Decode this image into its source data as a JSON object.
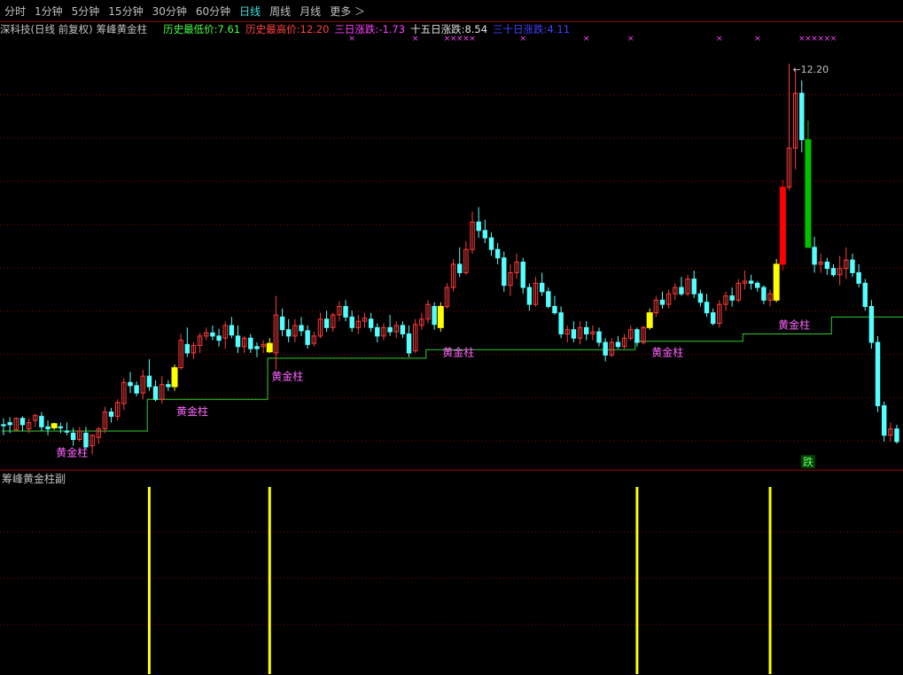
{
  "toolbar": {
    "tabs": [
      "分时",
      "1分钟",
      "5分钟",
      "15分钟",
      "30分钟",
      "60分钟",
      "日线",
      "周线",
      "月线",
      "更多 ＞"
    ],
    "active": "日线"
  },
  "info": {
    "stock": "深科技(日线 前复权)",
    "indicator": "筹峰黄金柱",
    "low_label": "历史最低价:",
    "low_value": "7.61",
    "high_label": "历史最高价:",
    "high_value": "12.20",
    "d3_label": "三日涨跌:",
    "d3_value": "-1.73",
    "d15_label": "十五日涨跌:",
    "d15_value": "8.54",
    "d30_label": "三十日涨跌:",
    "d30_value": "4.11"
  },
  "sub_title": "筹峰黄金柱副",
  "colors": {
    "up": "#ff3a3a",
    "down": "#54ffff",
    "gold": "#ffff00",
    "line": "#33cc33",
    "label": "#ff66ff",
    "grid": "#8b0000",
    "strong_up": "#ff0000",
    "strong_down": "#00c000"
  },
  "chart_data": {
    "type": "candlestick",
    "high_marker": "12.20",
    "gold_label": "黄金柱",
    "fall_label": "跌",
    "candles": [
      {
        "o": 8.78,
        "h": 8.84,
        "l": 8.68,
        "c": 8.77
      },
      {
        "o": 8.8,
        "h": 8.85,
        "l": 8.7,
        "c": 8.78
      },
      {
        "o": 8.73,
        "h": 8.85,
        "l": 8.73,
        "c": 8.84
      },
      {
        "o": 8.84,
        "h": 8.86,
        "l": 8.72,
        "c": 8.78
      },
      {
        "o": 8.74,
        "h": 8.84,
        "l": 8.7,
        "c": 8.8
      },
      {
        "o": 8.82,
        "h": 8.88,
        "l": 8.76,
        "c": 8.87
      },
      {
        "o": 8.86,
        "h": 8.9,
        "l": 8.72,
        "c": 8.76
      },
      {
        "o": 8.76,
        "h": 8.82,
        "l": 8.68,
        "c": 8.74
      },
      {
        "o": 8.75,
        "h": 8.8,
        "l": 8.73,
        "c": 8.79,
        "g": 1
      },
      {
        "o": 8.76,
        "h": 8.8,
        "l": 8.7,
        "c": 8.75
      },
      {
        "o": 8.72,
        "h": 8.8,
        "l": 8.68,
        "c": 8.71
      },
      {
        "o": 8.7,
        "h": 8.75,
        "l": 8.58,
        "c": 8.64
      },
      {
        "o": 8.64,
        "h": 8.76,
        "l": 8.62,
        "c": 8.72
      },
      {
        "o": 8.7,
        "h": 8.76,
        "l": 8.55,
        "c": 8.57
      },
      {
        "o": 8.58,
        "h": 8.69,
        "l": 8.5,
        "c": 8.68
      },
      {
        "o": 8.66,
        "h": 8.76,
        "l": 8.6,
        "c": 8.74
      },
      {
        "o": 8.74,
        "h": 8.95,
        "l": 8.7,
        "c": 8.9
      },
      {
        "o": 8.9,
        "h": 8.94,
        "l": 8.8,
        "c": 8.86
      },
      {
        "o": 8.86,
        "h": 9.02,
        "l": 8.82,
        "c": 8.99
      },
      {
        "o": 8.98,
        "h": 9.22,
        "l": 8.92,
        "c": 9.18
      },
      {
        "o": 9.18,
        "h": 9.28,
        "l": 9.08,
        "c": 9.15
      },
      {
        "o": 9.15,
        "h": 9.19,
        "l": 9.05,
        "c": 9.08
      },
      {
        "o": 9.08,
        "h": 9.3,
        "l": 9.02,
        "c": 9.24
      },
      {
        "o": 9.24,
        "h": 9.4,
        "l": 9.1,
        "c": 9.14
      },
      {
        "o": 9.14,
        "h": 9.2,
        "l": 9.0,
        "c": 9.02
      },
      {
        "o": 9.02,
        "h": 9.24,
        "l": 8.98,
        "c": 9.16
      },
      {
        "o": 9.16,
        "h": 9.2,
        "l": 9.1,
        "c": 9.14
      },
      {
        "o": 9.14,
        "h": 9.35,
        "l": 9.1,
        "c": 9.32,
        "g": 1
      },
      {
        "o": 9.32,
        "h": 9.64,
        "l": 9.3,
        "c": 9.58
      },
      {
        "o": 9.54,
        "h": 9.7,
        "l": 9.42,
        "c": 9.46
      },
      {
        "o": 9.46,
        "h": 9.56,
        "l": 9.4,
        "c": 9.53
      },
      {
        "o": 9.53,
        "h": 9.65,
        "l": 9.46,
        "c": 9.62
      },
      {
        "o": 9.62,
        "h": 9.7,
        "l": 9.58,
        "c": 9.65
      },
      {
        "o": 9.65,
        "h": 9.72,
        "l": 9.58,
        "c": 9.62
      },
      {
        "o": 9.62,
        "h": 9.69,
        "l": 9.52,
        "c": 9.58
      },
      {
        "o": 9.6,
        "h": 9.76,
        "l": 9.5,
        "c": 9.72
      },
      {
        "o": 9.72,
        "h": 9.8,
        "l": 9.6,
        "c": 9.63
      },
      {
        "o": 9.62,
        "h": 9.72,
        "l": 9.46,
        "c": 9.52
      },
      {
        "o": 9.52,
        "h": 9.62,
        "l": 9.46,
        "c": 9.6
      },
      {
        "o": 9.6,
        "h": 9.64,
        "l": 9.46,
        "c": 9.5
      },
      {
        "o": 9.52,
        "h": 9.56,
        "l": 9.42,
        "c": 9.5
      },
      {
        "o": 9.52,
        "h": 9.58,
        "l": 9.46,
        "c": 9.54
      },
      {
        "o": 9.55,
        "h": 9.6,
        "l": 9.46,
        "c": 9.47,
        "g": 1
      },
      {
        "o": 9.46,
        "h": 10.0,
        "l": 9.3,
        "c": 9.82
      },
      {
        "o": 9.8,
        "h": 9.88,
        "l": 9.62,
        "c": 9.68
      },
      {
        "o": 9.68,
        "h": 9.78,
        "l": 9.56,
        "c": 9.62
      },
      {
        "o": 9.62,
        "h": 9.78,
        "l": 9.56,
        "c": 9.72
      },
      {
        "o": 9.72,
        "h": 9.8,
        "l": 9.62,
        "c": 9.67
      },
      {
        "o": 9.67,
        "h": 9.72,
        "l": 9.5,
        "c": 9.54
      },
      {
        "o": 9.55,
        "h": 9.66,
        "l": 9.52,
        "c": 9.62
      },
      {
        "o": 9.62,
        "h": 9.84,
        "l": 9.6,
        "c": 9.78
      },
      {
        "o": 9.78,
        "h": 9.86,
        "l": 9.66,
        "c": 9.7
      },
      {
        "o": 9.7,
        "h": 9.84,
        "l": 9.66,
        "c": 9.82
      },
      {
        "o": 9.82,
        "h": 9.95,
        "l": 9.76,
        "c": 9.9
      },
      {
        "o": 9.9,
        "h": 9.96,
        "l": 9.76,
        "c": 9.8
      },
      {
        "o": 9.8,
        "h": 9.86,
        "l": 9.66,
        "c": 9.7
      },
      {
        "o": 9.7,
        "h": 9.82,
        "l": 9.64,
        "c": 9.76
      },
      {
        "o": 9.76,
        "h": 9.84,
        "l": 9.7,
        "c": 9.79
      },
      {
        "o": 9.78,
        "h": 9.84,
        "l": 9.66,
        "c": 9.7
      },
      {
        "o": 9.7,
        "h": 9.74,
        "l": 9.56,
        "c": 9.62
      },
      {
        "o": 9.62,
        "h": 9.74,
        "l": 9.58,
        "c": 9.7
      },
      {
        "o": 9.7,
        "h": 9.82,
        "l": 9.62,
        "c": 9.66
      },
      {
        "o": 9.66,
        "h": 9.76,
        "l": 9.6,
        "c": 9.72
      },
      {
        "o": 9.72,
        "h": 9.76,
        "l": 9.6,
        "c": 9.64
      },
      {
        "o": 9.64,
        "h": 9.72,
        "l": 9.42,
        "c": 9.46
      },
      {
        "o": 9.48,
        "h": 9.78,
        "l": 9.46,
        "c": 9.73
      },
      {
        "o": 9.72,
        "h": 9.84,
        "l": 9.68,
        "c": 9.78
      },
      {
        "o": 9.78,
        "h": 9.96,
        "l": 9.74,
        "c": 9.92
      },
      {
        "o": 9.9,
        "h": 9.94,
        "l": 9.68,
        "c": 9.73
      },
      {
        "o": 9.7,
        "h": 9.94,
        "l": 9.66,
        "c": 9.9,
        "g": 1
      },
      {
        "o": 9.9,
        "h": 10.12,
        "l": 9.88,
        "c": 10.08
      },
      {
        "o": 10.08,
        "h": 10.35,
        "l": 10.04,
        "c": 10.3
      },
      {
        "o": 10.3,
        "h": 10.46,
        "l": 10.18,
        "c": 10.22
      },
      {
        "o": 10.22,
        "h": 10.52,
        "l": 10.2,
        "c": 10.44
      },
      {
        "o": 10.44,
        "h": 10.8,
        "l": 10.4,
        "c": 10.7
      },
      {
        "o": 10.7,
        "h": 10.84,
        "l": 10.55,
        "c": 10.62
      },
      {
        "o": 10.62,
        "h": 10.72,
        "l": 10.5,
        "c": 10.55
      },
      {
        "o": 10.55,
        "h": 10.6,
        "l": 10.38,
        "c": 10.44
      },
      {
        "o": 10.44,
        "h": 10.5,
        "l": 10.3,
        "c": 10.36
      },
      {
        "o": 10.36,
        "h": 10.42,
        "l": 10.04,
        "c": 10.1
      },
      {
        "o": 10.1,
        "h": 10.3,
        "l": 10.0,
        "c": 10.22
      },
      {
        "o": 10.22,
        "h": 10.4,
        "l": 10.16,
        "c": 10.32
      },
      {
        "o": 10.32,
        "h": 10.36,
        "l": 10.02,
        "c": 10.08
      },
      {
        "o": 10.08,
        "h": 10.12,
        "l": 9.86,
        "c": 9.92
      },
      {
        "o": 9.92,
        "h": 10.18,
        "l": 9.9,
        "c": 10.12
      },
      {
        "o": 10.12,
        "h": 10.22,
        "l": 10.0,
        "c": 10.04
      },
      {
        "o": 10.04,
        "h": 10.08,
        "l": 9.88,
        "c": 9.9
      },
      {
        "o": 9.9,
        "h": 10.0,
        "l": 9.82,
        "c": 9.84
      },
      {
        "o": 9.84,
        "h": 9.9,
        "l": 9.6,
        "c": 9.64
      },
      {
        "o": 9.64,
        "h": 9.72,
        "l": 9.56,
        "c": 9.68
      },
      {
        "o": 9.68,
        "h": 9.76,
        "l": 9.56,
        "c": 9.6
      },
      {
        "o": 9.6,
        "h": 9.76,
        "l": 9.54,
        "c": 9.7
      },
      {
        "o": 9.7,
        "h": 9.76,
        "l": 9.58,
        "c": 9.64
      },
      {
        "o": 9.64,
        "h": 9.72,
        "l": 9.58,
        "c": 9.66
      },
      {
        "o": 9.66,
        "h": 9.7,
        "l": 9.52,
        "c": 9.56
      },
      {
        "o": 9.56,
        "h": 9.6,
        "l": 9.38,
        "c": 9.44
      },
      {
        "o": 9.44,
        "h": 9.6,
        "l": 9.42,
        "c": 9.56
      },
      {
        "o": 9.56,
        "h": 9.62,
        "l": 9.5,
        "c": 9.52
      },
      {
        "o": 9.52,
        "h": 9.64,
        "l": 9.5,
        "c": 9.6
      },
      {
        "o": 9.6,
        "h": 9.72,
        "l": 9.58,
        "c": 9.68
      },
      {
        "o": 9.68,
        "h": 9.7,
        "l": 9.52,
        "c": 9.56
      },
      {
        "o": 9.56,
        "h": 9.72,
        "l": 9.54,
        "c": 9.7
      },
      {
        "o": 9.7,
        "h": 9.88,
        "l": 9.68,
        "c": 9.84,
        "g": 1
      },
      {
        "o": 9.84,
        "h": 10.0,
        "l": 9.8,
        "c": 9.96
      },
      {
        "o": 9.96,
        "h": 10.04,
        "l": 9.88,
        "c": 9.92
      },
      {
        "o": 9.92,
        "h": 10.06,
        "l": 9.88,
        "c": 10.02
      },
      {
        "o": 10.02,
        "h": 10.12,
        "l": 9.96,
        "c": 10.08
      },
      {
        "o": 10.08,
        "h": 10.18,
        "l": 10.0,
        "c": 10.02
      },
      {
        "o": 10.02,
        "h": 10.2,
        "l": 10.0,
        "c": 10.16
      },
      {
        "o": 10.16,
        "h": 10.24,
        "l": 9.98,
        "c": 10.02
      },
      {
        "o": 10.02,
        "h": 10.06,
        "l": 9.9,
        "c": 9.94
      },
      {
        "o": 9.94,
        "h": 10.02,
        "l": 9.8,
        "c": 9.84
      },
      {
        "o": 9.84,
        "h": 9.88,
        "l": 9.72,
        "c": 9.74
      },
      {
        "o": 9.74,
        "h": 9.96,
        "l": 9.7,
        "c": 9.92
      },
      {
        "o": 9.92,
        "h": 10.04,
        "l": 9.86,
        "c": 10.0
      },
      {
        "o": 10.0,
        "h": 10.08,
        "l": 9.9,
        "c": 9.96
      },
      {
        "o": 9.96,
        "h": 10.16,
        "l": 9.94,
        "c": 10.12
      },
      {
        "o": 10.12,
        "h": 10.24,
        "l": 10.06,
        "c": 10.14
      },
      {
        "o": 10.14,
        "h": 10.2,
        "l": 10.06,
        "c": 10.12
      },
      {
        "o": 10.12,
        "h": 10.14,
        "l": 10.04,
        "c": 10.08
      },
      {
        "o": 10.08,
        "h": 10.1,
        "l": 9.92,
        "c": 9.96
      },
      {
        "o": 9.96,
        "h": 10.06,
        "l": 9.9,
        "c": 10.02
      },
      {
        "o": 9.96,
        "h": 10.35,
        "l": 9.94,
        "c": 10.3,
        "g": 1
      },
      {
        "o": 10.3,
        "h": 11.1,
        "l": 10.24,
        "c": 11.03,
        "big": 1
      },
      {
        "o": 11.03,
        "h": 12.2,
        "l": 11.0,
        "c": 11.4
      },
      {
        "o": 11.4,
        "h": 12.15,
        "l": 11.2,
        "c": 11.92
      },
      {
        "o": 11.92,
        "h": 12.04,
        "l": 11.36,
        "c": 11.48
      },
      {
        "o": 11.48,
        "h": 11.66,
        "l": 10.46,
        "c": 10.46,
        "fall": 1
      },
      {
        "o": 10.46,
        "h": 10.56,
        "l": 10.22,
        "c": 10.3
      },
      {
        "o": 10.3,
        "h": 10.4,
        "l": 10.22,
        "c": 10.32
      },
      {
        "o": 10.32,
        "h": 10.36,
        "l": 10.2,
        "c": 10.26
      },
      {
        "o": 10.26,
        "h": 10.3,
        "l": 10.18,
        "c": 10.2
      },
      {
        "o": 10.2,
        "h": 10.38,
        "l": 10.1,
        "c": 10.26
      },
      {
        "o": 10.26,
        "h": 10.46,
        "l": 10.16,
        "c": 10.34
      },
      {
        "o": 10.34,
        "h": 10.4,
        "l": 10.18,
        "c": 10.22
      },
      {
        "o": 10.22,
        "h": 10.3,
        "l": 10.08,
        "c": 10.12
      },
      {
        "o": 10.12,
        "h": 10.16,
        "l": 9.86,
        "c": 9.9
      },
      {
        "o": 9.9,
        "h": 9.96,
        "l": 9.5,
        "c": 9.56
      },
      {
        "o": 9.56,
        "h": 9.62,
        "l": 8.9,
        "c": 8.96
      },
      {
        "o": 8.96,
        "h": 9.0,
        "l": 8.62,
        "c": 8.68
      },
      {
        "o": 8.68,
        "h": 8.8,
        "l": 8.62,
        "c": 8.74
      },
      {
        "o": 8.74,
        "h": 8.78,
        "l": 8.6,
        "c": 8.62
      }
    ],
    "support_levels": [
      8.72,
      9.02,
      9.41,
      9.49,
      9.57,
      9.64,
      9.8,
      9.8
    ],
    "support_breaks": [
      0,
      23,
      42,
      67,
      100,
      117,
      131,
      150
    ],
    "sub_bars": [
      23,
      42,
      100,
      121
    ],
    "star_markers": [
      55,
      65,
      70,
      71,
      72,
      73,
      74,
      82,
      92,
      99,
      113,
      119,
      126,
      127,
      128,
      129,
      130,
      131,
      144
    ]
  }
}
